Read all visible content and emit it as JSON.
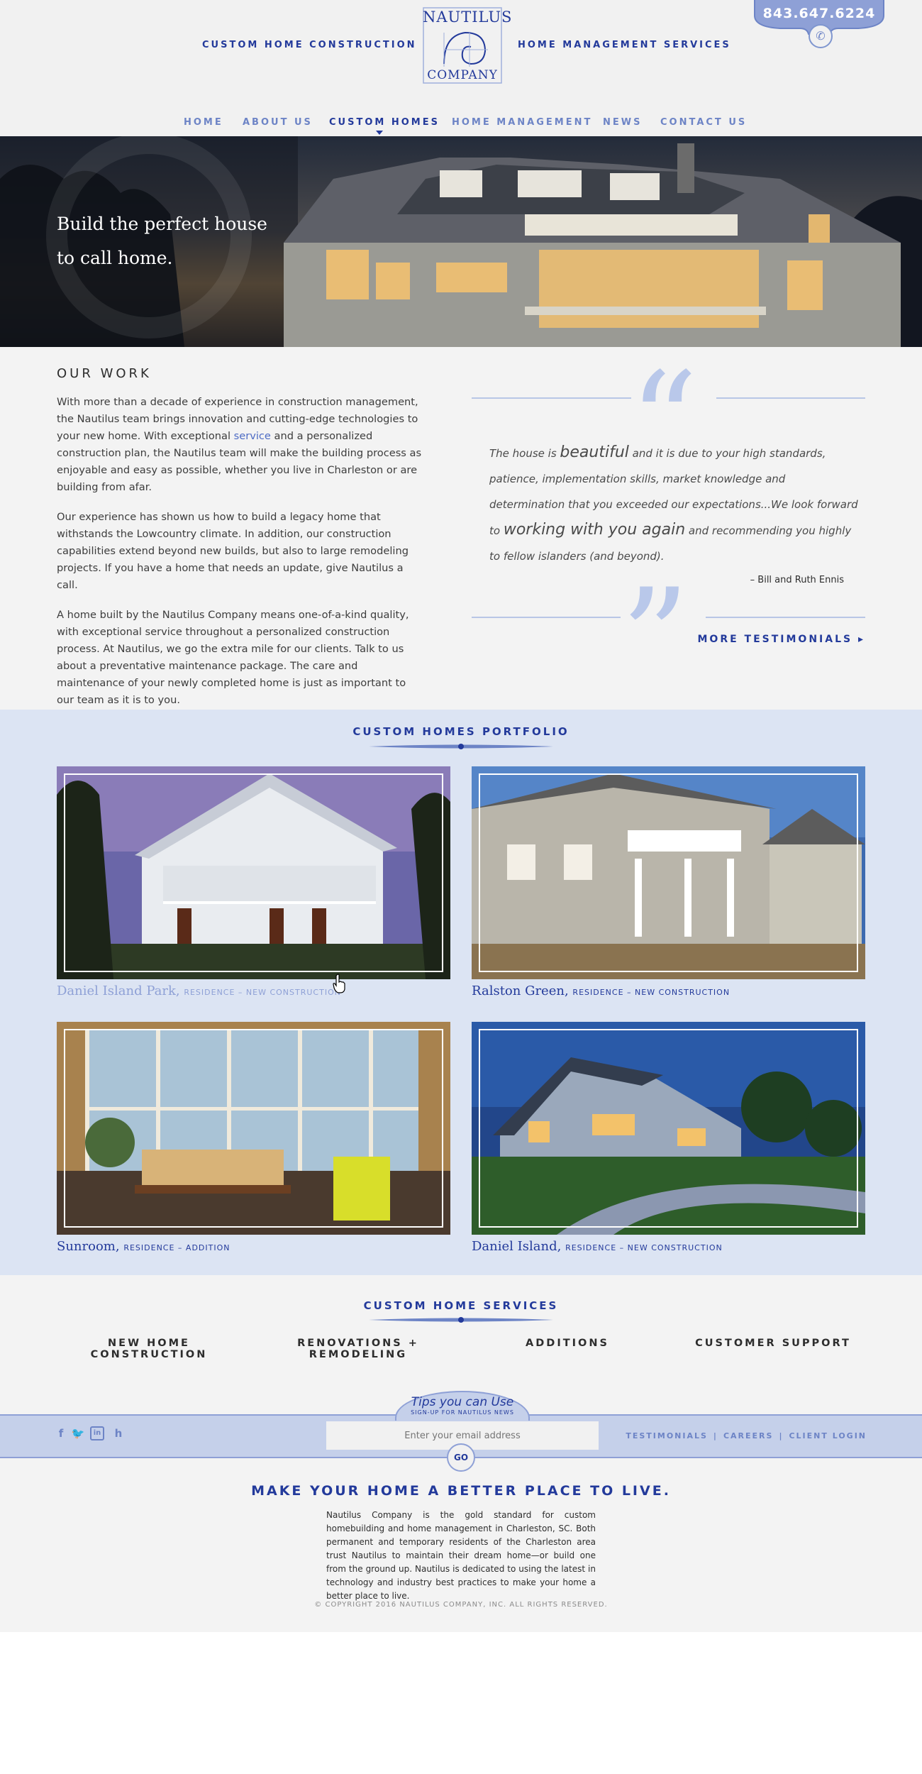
{
  "header": {
    "left_label": "CUSTOM HOME CONSTRUCTION",
    "right_label": "HOME MANAGEMENT SERVICES",
    "logo_line1": "NAUTILUS",
    "logo_line2": "COMPANY",
    "phone": "843.647.6224"
  },
  "nav": [
    {
      "label": "HOME"
    },
    {
      "label": "ABOUT US"
    },
    {
      "label": "CUSTOM HOMES"
    },
    {
      "label": "HOME MANAGEMENT"
    },
    {
      "label": "NEWS"
    },
    {
      "label": "CONTACT US"
    }
  ],
  "hero": {
    "line1": "Build the perfect house",
    "line2": "to call home."
  },
  "our_work": {
    "title": "OUR WORK",
    "p1_before": "With more than a decade of experience in construction management, the Nautilus team brings innovation and cutting-edge technologies to your new home. With exceptional ",
    "p1_link": "service",
    "p1_after": " and a personalized construction plan, the Nautilus team will make the building process as enjoyable and easy as possible, whether you live in Charleston or are building from afar.",
    "p2": "Our experience has shown us how to build a legacy home that withstands the Lowcountry climate. In addition, our construction capabilities extend beyond new builds, but also to large remodeling projects. If you have a home that needs an update, give Nautilus a call.",
    "p3": "A home built by the Nautilus Company means one-of-a-kind quality, with exceptional service throughout a personalized construction process. At Nautilus, we go the extra mile for our clients. Talk to us about a preventative maintenance package. The care and maintenance of your newly completed home is just as important to our team as it is to you."
  },
  "testimonial": {
    "t1": "The house is ",
    "t2": "beautiful",
    "t3": " and it is due to your high standards, patience, implementation skills, market knowledge and determination that you exceeded our expectations...We look forward to ",
    "t4": "working with you again",
    "t5": " and recommending you highly to fellow islanders (and beyond).",
    "author": "– Bill and Ruth Ennis",
    "more": "MORE TESTIMONIALS"
  },
  "portfolio": {
    "title": "CUSTOM HOMES PORTFOLIO",
    "items": [
      {
        "name": "Daniel Island Park,",
        "sub": "RESIDENCE – NEW CONSTRUCTION"
      },
      {
        "name": "Ralston Green,",
        "sub": "RESIDENCE – NEW CONSTRUCTION"
      },
      {
        "name": "Sunroom,",
        "sub": "RESIDENCE – ADDITION"
      },
      {
        "name": "Daniel Island,",
        "sub": "RESIDENCE – NEW CONSTRUCTION"
      }
    ]
  },
  "services": {
    "title": "CUSTOM HOME SERVICES",
    "items": [
      {
        "label": "NEW HOME CONSTRUCTION"
      },
      {
        "label_line1": "RENOVATIONS +",
        "label_line2": "REMODELING"
      },
      {
        "label": "ADDITIONS"
      },
      {
        "label": "CUSTOMER SUPPORT"
      }
    ]
  },
  "footer": {
    "tips_title": "Tips you can Use",
    "tips_sub": "SIGN-UP FOR NAUTILUS NEWS",
    "email_placeholder": "Enter your email address",
    "go": "GO",
    "links": [
      {
        "label": "TESTIMONIALS"
      },
      {
        "label": "CAREERS"
      },
      {
        "label": "CLIENT LOGIN"
      }
    ],
    "tagline": "MAKE YOUR HOME A BETTER PLACE TO LIVE.",
    "about": "Nautilus Company is the gold standard for custom homebuilding and home management in Charleston, SC. Both permanent and temporary residents of the Charleston area trust Nautilus to maintain their dream home—or build one from the ground up. Nautilus is dedicated to using the latest in technology and industry best practices to make your home a better place to live.",
    "copyright": "© COPYRIGHT 2016 NAUTILUS COMPANY, INC. ALL RIGHTS RESERVED.",
    "social": [
      {
        "icon": "facebook-icon"
      },
      {
        "icon": "twitter-icon"
      },
      {
        "icon": "linkedin-icon"
      },
      {
        "icon": "houzz-icon"
      }
    ]
  },
  "colors": {
    "brand": "#233a9b",
    "accent_light": "#6d84c6",
    "portfolio_bg": "#dce4f3"
  }
}
